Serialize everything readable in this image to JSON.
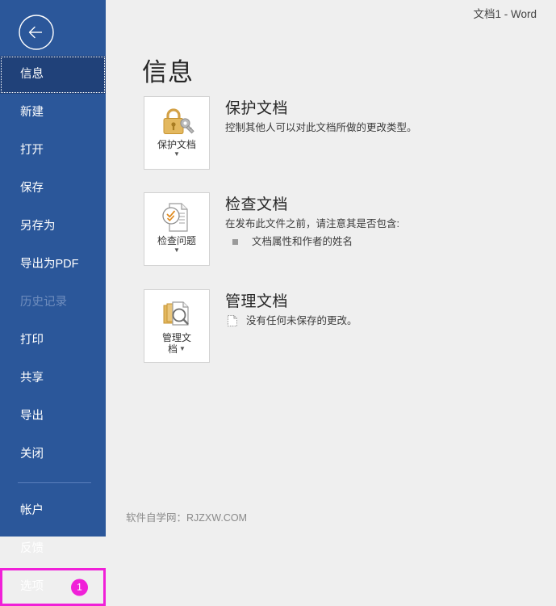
{
  "window": {
    "document_title": "文档1  -  Word"
  },
  "colors": {
    "sidebar_blue": "#2b579a",
    "sidebar_selected": "#204179",
    "accent_highlight": "#f020d8",
    "background": "#efefef",
    "icon_gold": "#d9a441",
    "icon_gray": "#8a8a8a"
  },
  "sidebar": {
    "back_button": {
      "name": "back-arrow",
      "icon": "arrow-left-circle-icon"
    },
    "items": [
      {
        "label": "信息",
        "state": "selected"
      },
      {
        "label": "新建",
        "state": "normal"
      },
      {
        "label": "打开",
        "state": "normal"
      },
      {
        "label": "保存",
        "state": "normal"
      },
      {
        "label": "另存为",
        "state": "normal"
      },
      {
        "label": "导出为PDF",
        "state": "normal"
      },
      {
        "label": "历史记录",
        "state": "disabled"
      },
      {
        "label": "打印",
        "state": "normal"
      },
      {
        "label": "共享",
        "state": "normal"
      },
      {
        "label": "导出",
        "state": "normal"
      },
      {
        "label": "关闭",
        "state": "normal"
      }
    ],
    "items_after_separator": [
      {
        "label": "帐户",
        "state": "normal"
      },
      {
        "label": "反馈",
        "state": "normal"
      },
      {
        "label": "选项",
        "state": "highlighted",
        "badge": "1"
      }
    ]
  },
  "main": {
    "heading": "信息",
    "sections": [
      {
        "tile_label": "保护文档",
        "tile_icon": "lock-key-icon",
        "title": "保护文档",
        "description": "控制其他人可以对此文档所做的更改类型。",
        "bullets": [],
        "note": null
      },
      {
        "tile_label": "检查问题",
        "tile_icon": "document-check-icon",
        "title": "检查文档",
        "description": "在发布此文件之前，请注意其是否包含:",
        "bullets": [
          "文档属性和作者的姓名"
        ],
        "note": null
      },
      {
        "tile_label": "管理文",
        "tile_label_line2": "档",
        "tile_icon": "documents-magnifier-icon",
        "title": "管理文档",
        "description": null,
        "bullets": [],
        "note": {
          "icon": "dashed-page-icon",
          "text": "没有任何未保存的更改。"
        }
      }
    ]
  },
  "watermark": {
    "text": "软件自学网：RJZXW.COM"
  }
}
